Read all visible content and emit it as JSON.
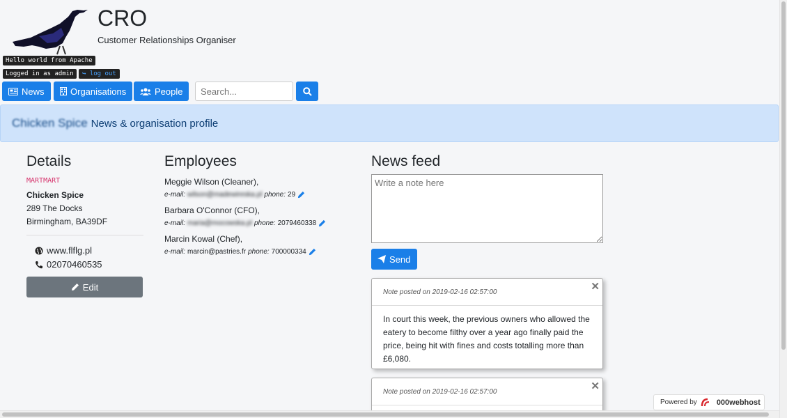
{
  "app": {
    "title": "CRO",
    "subtitle": "Customer Relationships Organiser"
  },
  "status": {
    "hello": "Hello world from Apache",
    "logged_in": "Logged in as admin",
    "logout": "log out"
  },
  "nav": {
    "news": "News",
    "organisations": "Organisations",
    "people": "People"
  },
  "search": {
    "placeholder": "Search..."
  },
  "banner": {
    "org_name": "Chicken Spice",
    "rest": "News & organisation profile"
  },
  "details": {
    "heading": "Details",
    "tag": "MARTMART",
    "name": "Chicken Spice",
    "street": "289 The Docks",
    "city": "Birmingham, BA39DF",
    "website": "www.flflg.pl",
    "phone": "02070460535",
    "edit_label": "Edit"
  },
  "employees": {
    "heading": "Employees",
    "email_label": "e-mail:",
    "phone_label": "phone:",
    "list": [
      {
        "name": "Meggie Wilson (Cleaner),",
        "email": "wilson@madewireska.pl",
        "phone": "29"
      },
      {
        "name": "Barbara O'Connor (CFO),",
        "email": "maria@mocowska.pl",
        "phone": "2079460338"
      },
      {
        "name": "Marcin Kowal (Chef),",
        "email": "marcin@pastries.fr",
        "phone": "700000334"
      }
    ]
  },
  "newsfeed": {
    "heading": "News feed",
    "placeholder": "Write a note here",
    "send_label": "Send",
    "notes": [
      {
        "header": "Note posted on 2019-02-16 02:57:00",
        "body": "In court this week, the previous owners who allowed the eatery to become filthy over a year ago finally paid the price, being hit with fines and costs totalling more than £6,080."
      },
      {
        "header": "Note posted on 2019-02-16 02:57:00",
        "body": ""
      }
    ]
  },
  "footer": {
    "powered_by": "Powered by",
    "host": "000webhost"
  },
  "colors": {
    "primary": "#1a7fe8",
    "banner": "#cfe3fb",
    "secondary": "#6c757d"
  }
}
